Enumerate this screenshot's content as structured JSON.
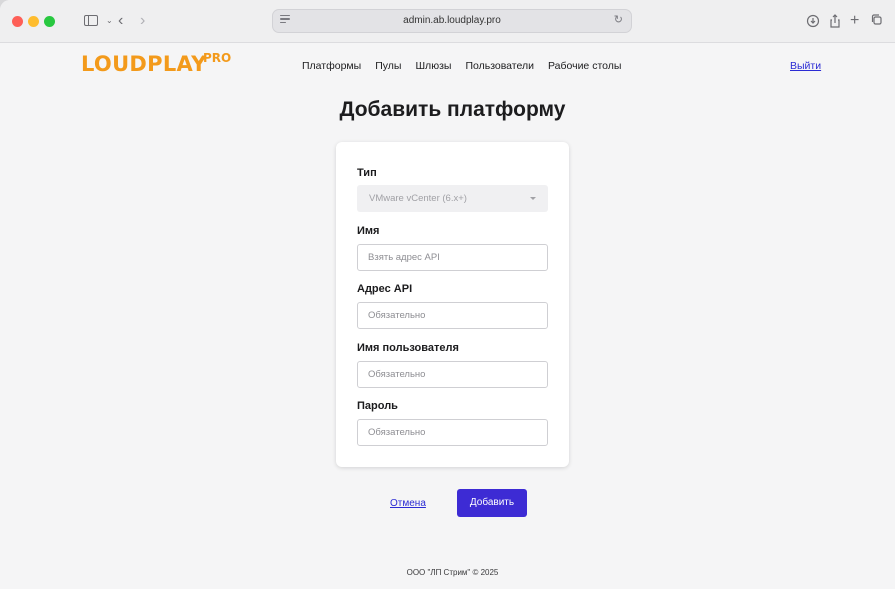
{
  "browser": {
    "url": "admin.ab.loudplay.pro"
  },
  "header": {
    "logo_text": "LOUDPLAY",
    "logo_sup": "PRO",
    "nav": [
      {
        "label": "Платформы"
      },
      {
        "label": "Пулы"
      },
      {
        "label": "Шлюзы"
      },
      {
        "label": "Пользователи"
      },
      {
        "label": "Рабочие столы"
      }
    ],
    "logout_label": "Выйти"
  },
  "page": {
    "title": "Добавить платформу"
  },
  "form": {
    "type_label": "Тип",
    "type_value": "VMware vCenter (6.x+)",
    "name_label": "Имя",
    "name_placeholder": "Взять адрес API",
    "api_label": "Адрес API",
    "api_placeholder": "Обязательно",
    "username_label": "Имя пользователя",
    "username_placeholder": "Обязательно",
    "password_label": "Пароль",
    "password_placeholder": "Обязательно"
  },
  "actions": {
    "cancel_label": "Отмена",
    "add_label": "Добавить"
  },
  "footer": {
    "text": "ООО \"ЛП Стрим\" © 2025"
  },
  "colors": {
    "brand_orange": "#f39a1b",
    "primary_button": "#3d2bd4",
    "link": "#2b2bd4"
  }
}
